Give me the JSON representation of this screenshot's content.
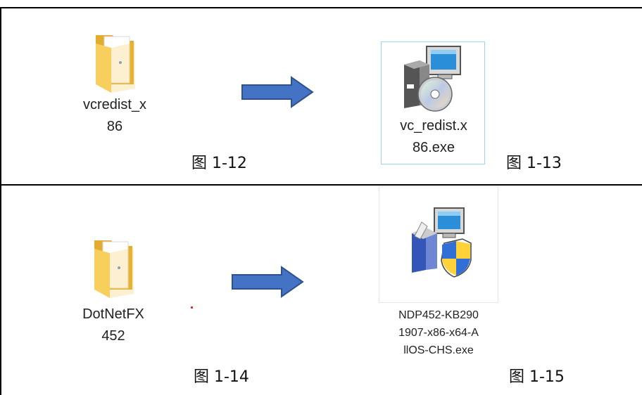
{
  "panels": {
    "top": {
      "source": {
        "icon": "folder-icon",
        "name": "vcredist_x\n86"
      },
      "target": {
        "icon": "installer-cd-icon",
        "name": "vc_redist.x\n86.exe"
      },
      "caption_left": "图 1-12",
      "caption_right": "图 1-13"
    },
    "bottom": {
      "source": {
        "icon": "folder-icon",
        "name": "DotNetFX\n452"
      },
      "target": {
        "icon": "installer-shield-icon",
        "name": "NDP452-KB290\n1907-x86-x64-A\nllOS-CHS.exe"
      },
      "caption_left": "图 1-14",
      "caption_right": "图 1-15"
    }
  },
  "colors": {
    "arrow_fill": "#4472c4",
    "arrow_stroke": "#2f528f",
    "selection_border": "#99d1ff",
    "folder": "#f5c242"
  }
}
